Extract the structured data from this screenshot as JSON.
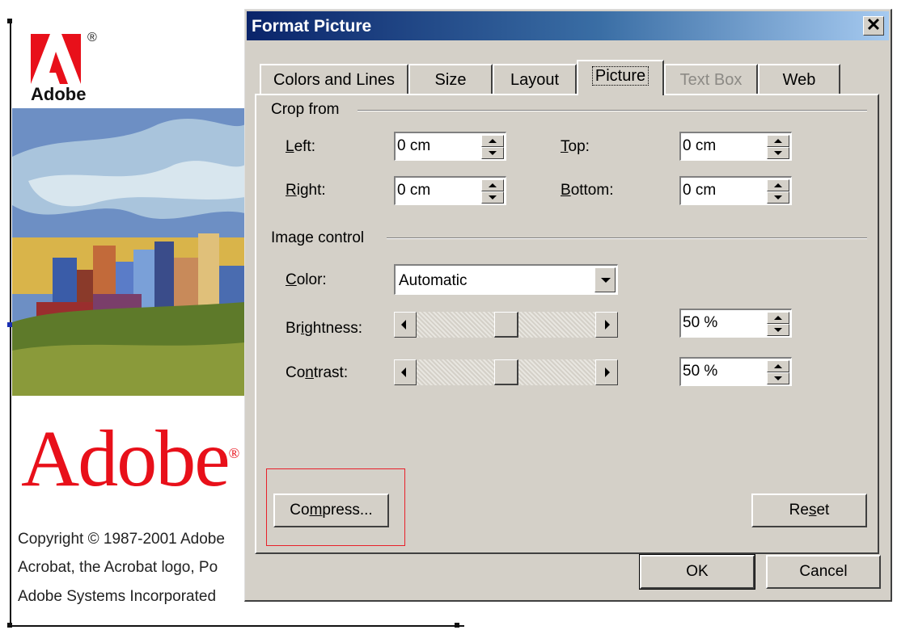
{
  "document": {
    "logo_word": "Adobe",
    "reg_mark": "®",
    "big_word": "Adobe",
    "lines": [
      "Copyright © 1987-2001 Adobe",
      "Acrobat, the Acrobat logo, Po",
      "Adobe Systems Incorporated"
    ],
    "colors": {
      "brand_red": "#e8101a"
    }
  },
  "dialog": {
    "title": "Format Picture",
    "close_glyph": "✕",
    "tabs": [
      {
        "label": "Colors and Lines",
        "state": "normal"
      },
      {
        "label": "Size",
        "state": "normal"
      },
      {
        "label": "Layout",
        "state": "normal"
      },
      {
        "label": "Picture",
        "state": "active"
      },
      {
        "label": "Text Box",
        "state": "disabled"
      },
      {
        "label": "Web",
        "state": "normal"
      }
    ],
    "crop": {
      "group_label": "Crop from",
      "left": {
        "label_pre": "",
        "mnemonic": "L",
        "label_post": "eft:",
        "value": "0 cm"
      },
      "right": {
        "label_pre": "",
        "mnemonic": "R",
        "label_post": "ight:",
        "value": "0 cm"
      },
      "top": {
        "label_pre": "",
        "mnemonic": "T",
        "label_post": "op:",
        "value": "0 cm"
      },
      "bottom": {
        "label_pre": "",
        "mnemonic": "B",
        "label_post": "ottom:",
        "value": "0 cm"
      }
    },
    "image_control": {
      "group_label": "Image control",
      "color": {
        "label_pre": "",
        "mnemonic": "C",
        "label_post": "olor:",
        "value": "Automatic"
      },
      "brightness": {
        "label_pre": "Br",
        "mnemonic": "i",
        "label_post": "ghtness:",
        "value": "50 %",
        "level": 0.5
      },
      "contrast": {
        "label_pre": "Co",
        "mnemonic": "n",
        "label_post": "trast:",
        "value": "50 %",
        "level": 0.5
      }
    },
    "buttons": {
      "compress_pre": "Co",
      "compress_mnemonic": "m",
      "compress_post": "press...",
      "reset_pre": "Re",
      "reset_mnemonic": "s",
      "reset_post": "et",
      "ok": "OK",
      "cancel": "Cancel"
    },
    "colors": {
      "title_start": "#0a246a",
      "title_end": "#a6caf0",
      "face": "#d4d0c8",
      "highlight": "#e8202a"
    }
  }
}
